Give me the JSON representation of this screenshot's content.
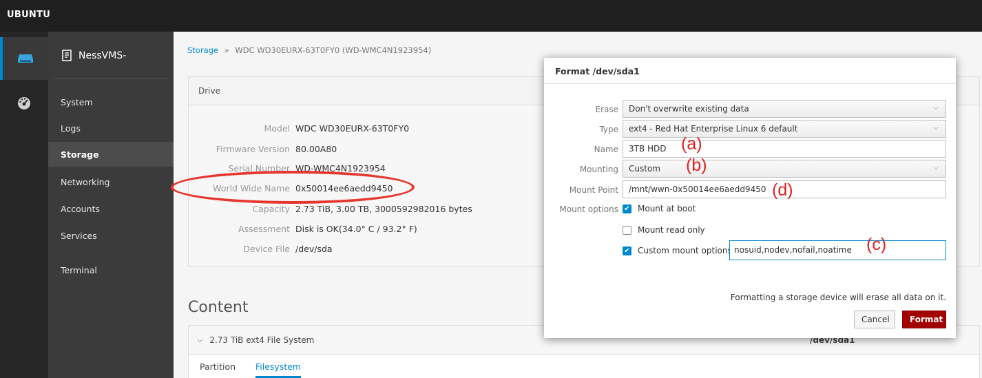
{
  "topbar": {
    "brand": "UBUNTU"
  },
  "rail": {
    "items": [
      "server-icon",
      "dashboard-icon"
    ]
  },
  "sidebar": {
    "host": "NessVMS-",
    "items": [
      {
        "label": "System"
      },
      {
        "label": "Logs"
      },
      {
        "label": "Storage",
        "active": true
      },
      {
        "label": "Networking"
      },
      {
        "label": "Accounts"
      },
      {
        "label": "Services"
      },
      {
        "label": "Terminal"
      }
    ]
  },
  "breadcrumb": {
    "root": "Storage",
    "separator": "»",
    "current": "WDC WD30EURX-63T0FY0 (WD-WMC4N1923954)"
  },
  "drive": {
    "heading": "Drive",
    "rows": [
      {
        "key": "Model",
        "value": "WDC WD30EURX-63T0FY0"
      },
      {
        "key": "Firmware Version",
        "value": "80.00A80"
      },
      {
        "key": "Serial Number",
        "value": "WD-WMC4N1923954"
      },
      {
        "key": "World Wide Name",
        "value": "0x50014ee6aedd9450"
      },
      {
        "key": "Capacity",
        "value": "2.73 TiB, 3.00 TB, 3000592982016 bytes"
      },
      {
        "key": "Assessment",
        "value": "Disk is OK(34.0° C / 93.2° F)"
      },
      {
        "key": "Device File",
        "value": "/dev/sda"
      }
    ]
  },
  "content": {
    "title": "Content",
    "filesystem": "2.73 TiB ext4 File System",
    "device": "/dev/sda1",
    "tabs": [
      "Partition",
      "Filesystem"
    ],
    "active_tab": "Filesystem"
  },
  "dialog": {
    "title": "Format /dev/sda1",
    "erase_label": "Erase",
    "erase_value": "Don't overwrite existing data",
    "type_label": "Type",
    "type_value": "ext4 - Red Hat Enterprise Linux 6 default",
    "name_label": "Name",
    "name_value": "3TB HDD",
    "mounting_label": "Mounting",
    "mounting_value": "Custom",
    "mount_point_label": "Mount Point",
    "mount_point_value": "/mnt/wwn-0x50014ee6aedd9450",
    "mount_options_label": "Mount options",
    "mount_at_boot": "Mount at boot",
    "mount_at_boot_checked": true,
    "mount_read_only": "Mount read only",
    "mount_read_only_checked": false,
    "custom_mount_options": "Custom mount options",
    "custom_mount_options_checked": true,
    "custom_mount_options_value": "nosuid,nodev,nofail,noatime",
    "warning": "Formatting a storage device will erase all data on it.",
    "cancel": "Cancel",
    "format": "Format"
  },
  "annotations": {
    "a": "(a)",
    "b": "(b)",
    "c": "(c)",
    "d": "(d)"
  },
  "colors": {
    "accent": "#0088ce",
    "danger": "#a30000",
    "annotation": "#e6372f"
  }
}
